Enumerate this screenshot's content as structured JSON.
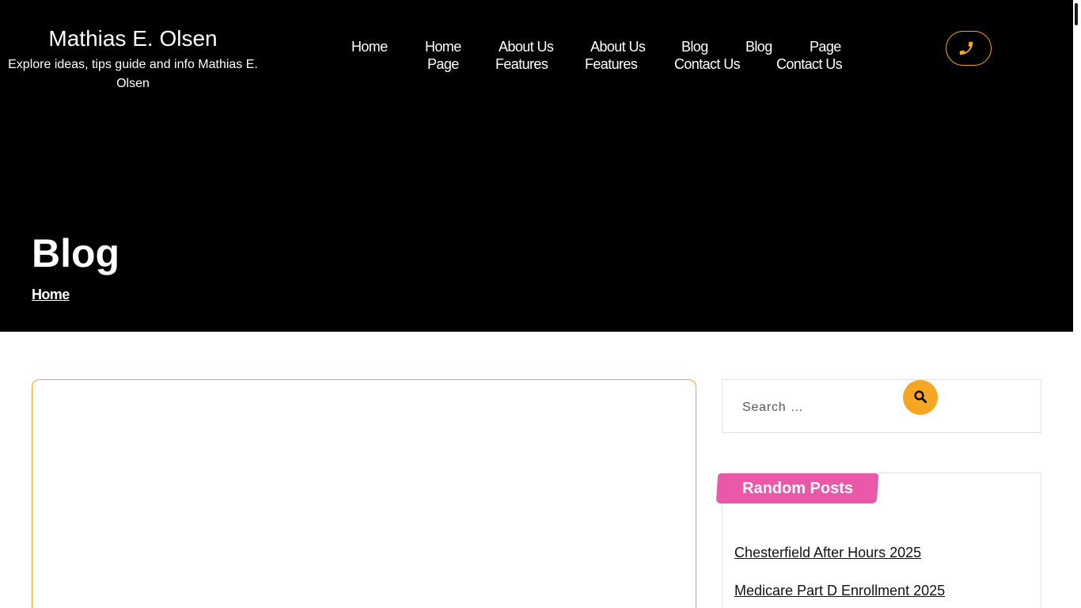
{
  "site": {
    "title": "Mathias E. Olsen",
    "tagline": "Explore ideas, tips guide and info Mathias E. Olsen"
  },
  "nav": {
    "row1": [
      "Home",
      "Home",
      "About Us",
      "About Us",
      "Blog",
      "Blog",
      "Page"
    ],
    "row2": [
      "Page",
      "Features",
      "Features",
      "Contact Us",
      "Contact Us"
    ]
  },
  "header": {
    "phone_icon": "phone-icon",
    "accent_color": "#f5a623"
  },
  "hero": {
    "title": "Blog",
    "breadcrumb": "Home"
  },
  "search": {
    "placeholder": "Search …",
    "icon": "search-icon"
  },
  "sidebar": {
    "random_posts_title": "Random Posts",
    "random_posts": [
      "Chesterfield After Hours 2025",
      "Medicare Part D Enrollment 2025"
    ],
    "widget_color": "#ea58aa"
  }
}
